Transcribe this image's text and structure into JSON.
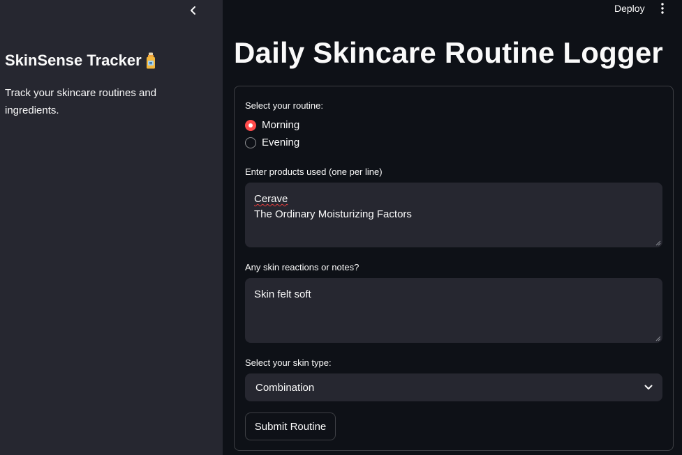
{
  "header": {
    "deploy_label": "Deploy",
    "menu_icon": "vertical-dots-icon"
  },
  "sidebar": {
    "collapse_icon": "chevron-left-icon",
    "title": "SkinSense Tracker",
    "title_icon": "lotion-bottle-icon",
    "description": "Track your skincare routines and ingredients."
  },
  "main": {
    "title": "Daily Skincare Routine Logger",
    "form": {
      "routine_label": "Select your routine:",
      "routine_options": [
        "Morning",
        "Evening"
      ],
      "routine_selected": "Morning",
      "products_label": "Enter products used (one per line)",
      "products_lines": [
        "Cerave",
        "The Ordinary Moisturizing Factors"
      ],
      "notes_label": "Any skin reactions or notes?",
      "notes_value": "Skin felt soft",
      "skin_type_label": "Select your skin type:",
      "skin_type_value": "Combination",
      "submit_label": "Submit Routine"
    }
  },
  "colors": {
    "accent": "#ff4b4b",
    "background": "#0e1117",
    "sidebar_bg": "#262730",
    "input_bg": "#262730",
    "text": "#fafafa"
  }
}
